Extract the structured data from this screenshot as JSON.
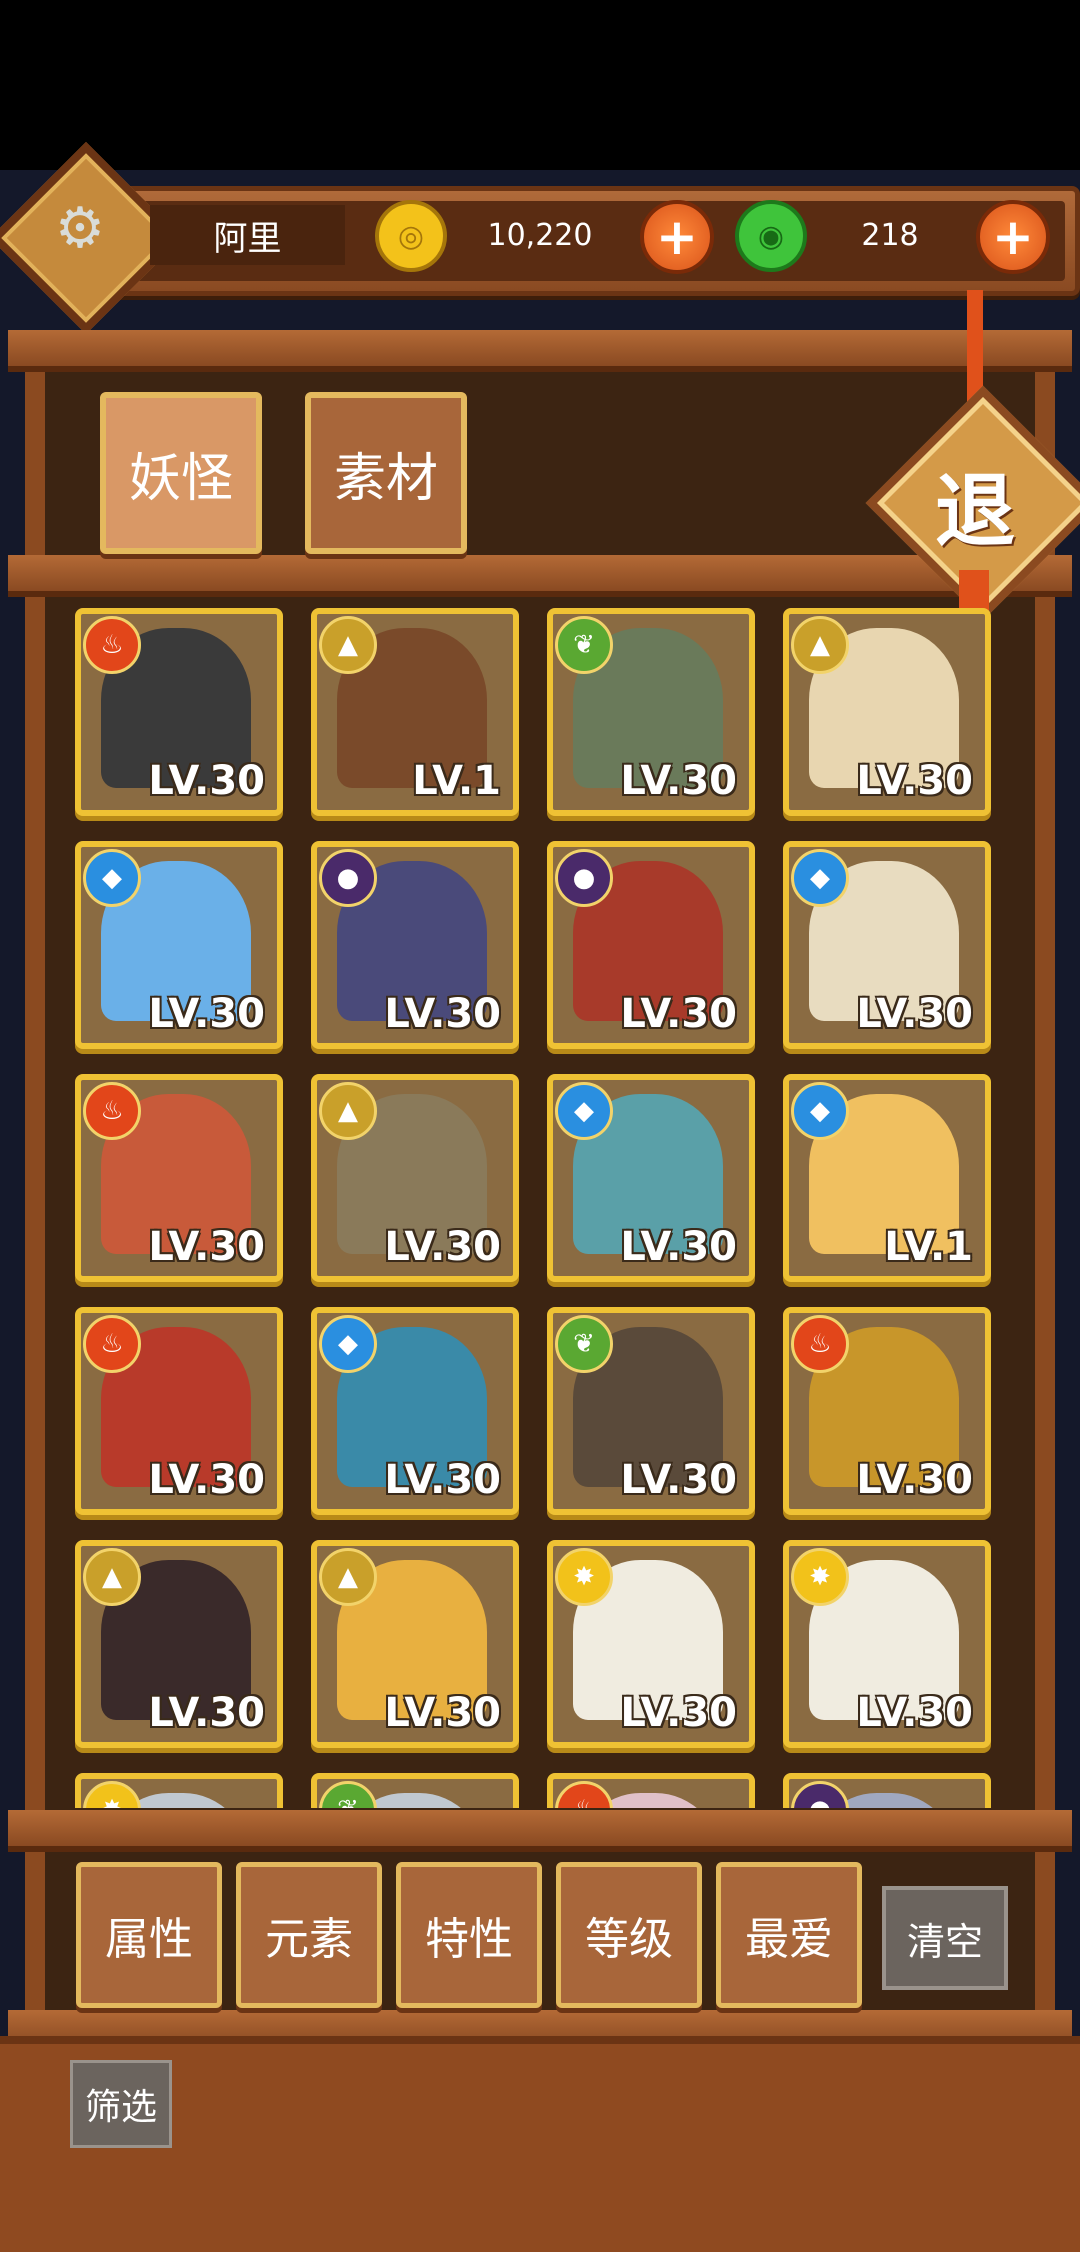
{
  "player": {
    "name": "阿里"
  },
  "resources": {
    "gold": {
      "value": "10,220",
      "color": "#f3c21a"
    },
    "jade": {
      "value": "218",
      "color": "#3fc43b"
    }
  },
  "tabs": [
    {
      "label": "妖怪",
      "active": true
    },
    {
      "label": "素材",
      "active": false
    }
  ],
  "exit_label": "退",
  "cards": [
    {
      "element": "fire",
      "level": "LV.30"
    },
    {
      "element": "earth",
      "level": "LV.1"
    },
    {
      "element": "wood",
      "level": "LV.30"
    },
    {
      "element": "earth",
      "level": "LV.30"
    },
    {
      "element": "water",
      "level": "LV.30"
    },
    {
      "element": "dark",
      "level": "LV.30"
    },
    {
      "element": "dark",
      "level": "LV.30"
    },
    {
      "element": "water",
      "level": "LV.30"
    },
    {
      "element": "fire",
      "level": "LV.30"
    },
    {
      "element": "earth",
      "level": "LV.30"
    },
    {
      "element": "water",
      "level": "LV.30"
    },
    {
      "element": "water",
      "level": "LV.1"
    },
    {
      "element": "fire",
      "level": "LV.30"
    },
    {
      "element": "water",
      "level": "LV.30"
    },
    {
      "element": "wood",
      "level": "LV.30"
    },
    {
      "element": "fire",
      "level": "LV.30"
    },
    {
      "element": "earth",
      "level": "LV.30"
    },
    {
      "element": "earth",
      "level": "LV.30"
    },
    {
      "element": "light",
      "level": "LV.30"
    },
    {
      "element": "light",
      "level": "LV.30"
    },
    {
      "element": "light",
      "level": ""
    },
    {
      "element": "wood",
      "level": ""
    },
    {
      "element": "fire",
      "level": ""
    },
    {
      "element": "dark",
      "level": ""
    }
  ],
  "element_colors": {
    "fire": "#e2461a",
    "water": "#2a8fe0",
    "wood": "#5aa832",
    "earth": "#c9a02a",
    "dark": "#4a2a6a",
    "light": "#f2c21a"
  },
  "filters": [
    "属性",
    "元素",
    "特性",
    "等级",
    "最爱"
  ],
  "clear_label": "清空",
  "filter_label": "筛选"
}
